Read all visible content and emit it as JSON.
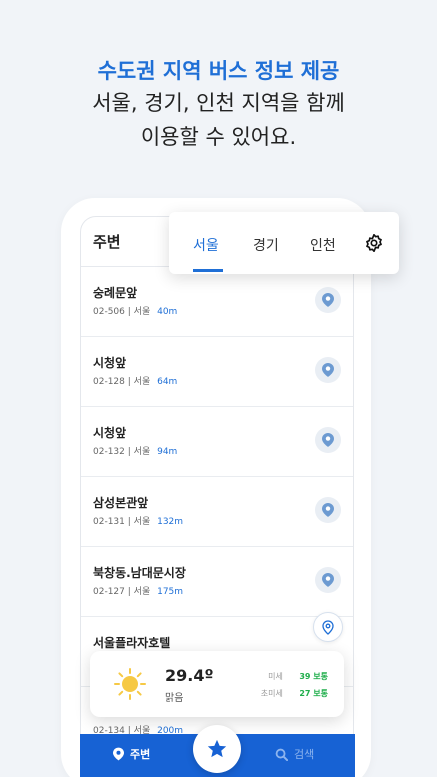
{
  "headline": {
    "title": "수도권 지역 버스 정보 제공",
    "line1": "서울, 경기, 인천 지역을 함께",
    "line2": "이용할 수 있어요."
  },
  "screen": {
    "title": "주변",
    "tabs": [
      {
        "label": "서울",
        "active": true
      },
      {
        "label": "경기",
        "active": false
      },
      {
        "label": "인천",
        "active": false
      }
    ],
    "settings_icon": "gear-icon",
    "stops": [
      {
        "name": "숭례문앞",
        "code": "02-506",
        "region": "서울",
        "distance": "40m"
      },
      {
        "name": "시청앞",
        "code": "02-128",
        "region": "서울",
        "distance": "64m"
      },
      {
        "name": "시청앞",
        "code": "02-132",
        "region": "서울",
        "distance": "94m"
      },
      {
        "name": "삼성본관앞",
        "code": "02-131",
        "region": "서울",
        "distance": "132m"
      },
      {
        "name": "북창동.남대문시장",
        "code": "02-127",
        "region": "서울",
        "distance": "175m"
      },
      {
        "name": "서울플라자호텔",
        "code": "",
        "region": "",
        "distance": ""
      }
    ],
    "peek_stop": {
      "code": "02-134",
      "region": "서울",
      "distance": "200m"
    }
  },
  "weather": {
    "temperature": "29.4º",
    "condition": "맑음",
    "fine_dust_label": "미세",
    "fine_dust_value": "39 보통",
    "ultrafine_dust_label": "초미세",
    "ultrafine_dust_value": "27 보통"
  },
  "nav": {
    "around_label": "주변",
    "search_label": "검색"
  },
  "colors": {
    "accent": "#1f6fd6",
    "nav_bg": "#1762d4",
    "good_status": "#1fae4b"
  }
}
